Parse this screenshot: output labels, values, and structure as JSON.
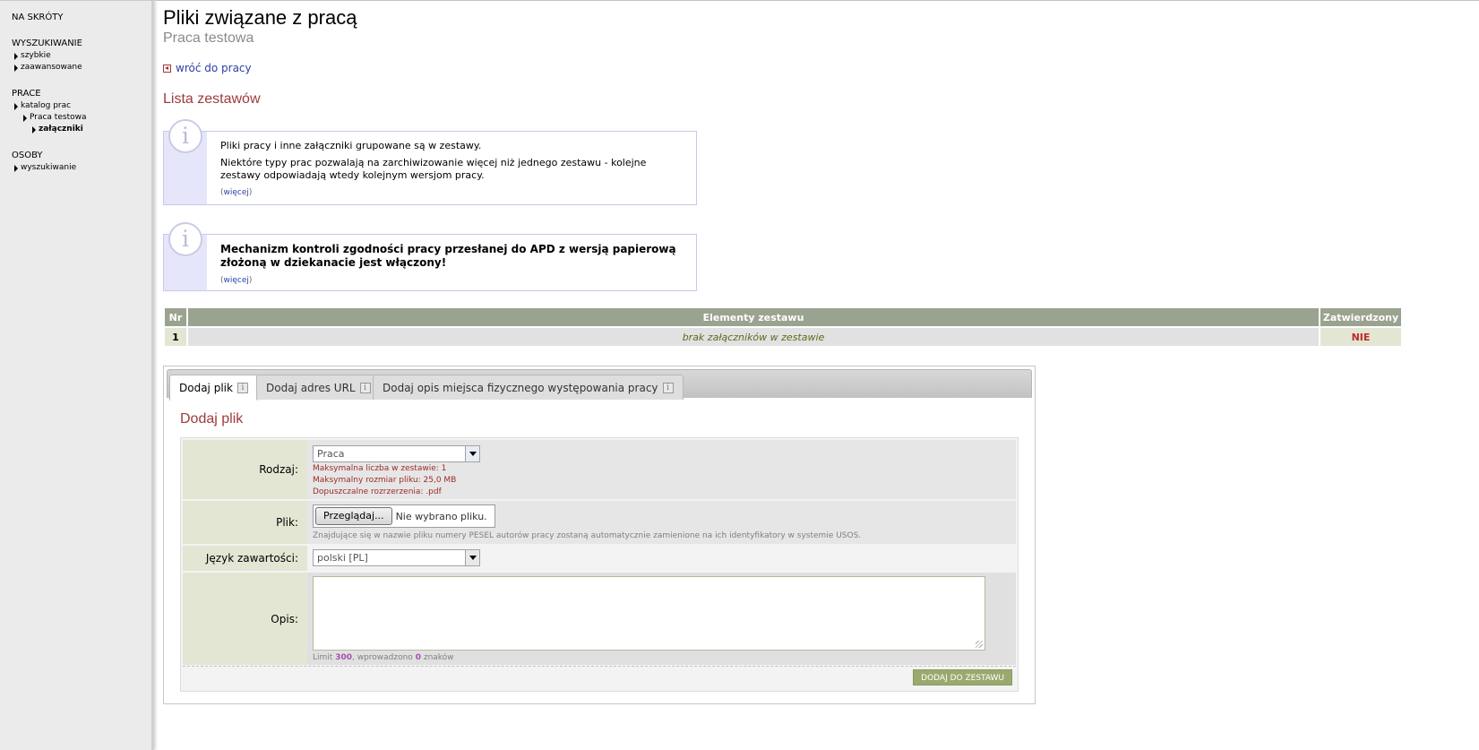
{
  "sidebar": {
    "shortcuts": "NA SKRÓTY",
    "search": {
      "heading": "WYSZUKIWANIE",
      "items": [
        "szybkie",
        "zaawansowane"
      ]
    },
    "works": {
      "heading": "PRACE",
      "catalog": "katalog prac",
      "work": "Praca testowa",
      "attachments": "załączniki"
    },
    "people": {
      "heading": "OSOBY",
      "items": [
        "wyszukiwanie"
      ]
    }
  },
  "header": {
    "title": "Pliki związane z pracą",
    "subtitle": "Praca testowa",
    "back_link": "wróć do pracy",
    "section_title": "Lista zestawów"
  },
  "info1": {
    "line1": "Pliki pracy i inne załączniki grupowane są w zestawy.",
    "line2": "Niektóre typy prac pozwalają na zarchiwizowanie więcej niż jednego zestawu - kolejne zestawy odpowiadają wtedy kolejnym wersjom pracy.",
    "more": "więcej"
  },
  "info2": {
    "text": "Mechanizm kontroli zgodności pracy przesłanej do APD z wersją papierową złożoną w dziekanacie jest włączony!",
    "more": "więcej"
  },
  "table": {
    "headers": {
      "nr": "Nr",
      "elements": "Elementy zestawu",
      "approved": "Zatwierdzony"
    },
    "rows": [
      {
        "nr": "1",
        "elements": "brak załączników w zestawie",
        "approved": "NIE"
      }
    ]
  },
  "tabs": {
    "add_file": "Dodaj plik",
    "add_url": "Dodaj adres URL",
    "add_location": "Dodaj opis miejsca fizycznego występowania pracy",
    "info_glyph": "i"
  },
  "form": {
    "title": "Dodaj plik",
    "type": {
      "label": "Rodzaj:",
      "value": "Praca",
      "hints": [
        "Maksymalna liczba w zestawie: 1",
        "Maksymalny rozmiar pliku: 25,0 MB",
        "Dopuszczalne rozrzerzenia: .pdf"
      ]
    },
    "file": {
      "label": "Plik:",
      "button": "Przeglądaj...",
      "status": "Nie wybrano pliku.",
      "hint": "Znajdujące się w nazwie pliku numery PESEL autorów pracy zostaną automatycznie zamienione na ich identyfikatory w systemie USOS."
    },
    "language": {
      "label": "Język zawartości:",
      "value": "polski [PL]"
    },
    "description": {
      "label": "Opis:",
      "limit_prefix": "Limit",
      "limit": "300",
      "entered_prefix": ", wprowadzono",
      "entered": "0",
      "entered_suffix": "znaków"
    },
    "submit": "DODAJ DO ZESTAWU"
  }
}
